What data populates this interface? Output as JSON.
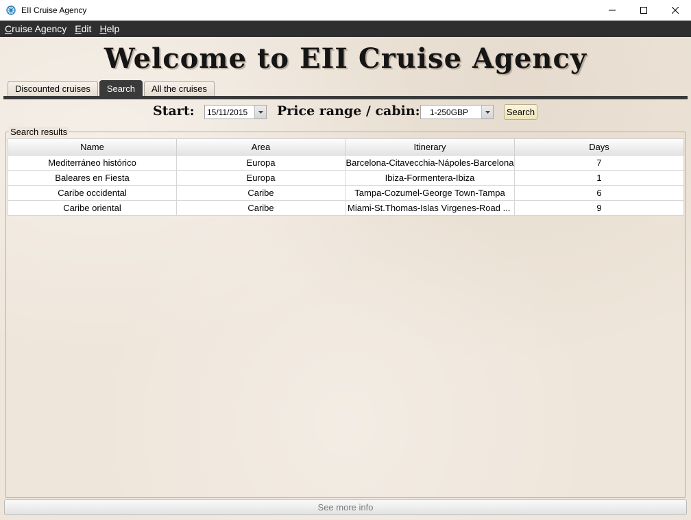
{
  "window": {
    "title": "EII Cruise Agency",
    "controls": {
      "minimize": "—",
      "maximize": "☐",
      "close": "✕"
    }
  },
  "menu": {
    "items": [
      {
        "underlined": "C",
        "rest": "ruise Agency"
      },
      {
        "underlined": "E",
        "rest": "dit"
      },
      {
        "underlined": "H",
        "rest": "elp"
      }
    ]
  },
  "header": {
    "welcome": "Welcome to EII Cruise Agency"
  },
  "tabs": [
    {
      "label": "Discounted cruises",
      "active": false
    },
    {
      "label": "Search",
      "active": true
    },
    {
      "label": "All the cruises",
      "active": false
    }
  ],
  "search": {
    "start_label": "Start:",
    "start_value": "15/11/2015",
    "price_label": "Price range / cabin:",
    "price_value": "1-250GBP",
    "button_label": "Search"
  },
  "results": {
    "group_title": "Search results",
    "columns": [
      "Name",
      "Area",
      "Itinerary",
      "Days"
    ],
    "rows": [
      [
        "Mediterráneo histórico",
        "Europa",
        "Barcelona-Citavecchia-Nápoles-Barcelona",
        "7"
      ],
      [
        "Baleares en Fiesta",
        "Europa",
        "Ibiza-Formentera-Ibiza",
        "1"
      ],
      [
        "Caribe occidental",
        "Caribe",
        "Tampa-Cozumel-George Town-Tampa",
        "6"
      ],
      [
        "Caribe oriental",
        "Caribe",
        "Miami-St.Thomas-Islas Virgenes-Road ...",
        "9"
      ]
    ]
  },
  "footer": {
    "more_button": "See more info"
  },
  "colors": {
    "menubar": "#2f2f2f",
    "content_bg": "#efe6db",
    "active_tab": "#3a3a3a",
    "search_button": "#efe3b8"
  }
}
